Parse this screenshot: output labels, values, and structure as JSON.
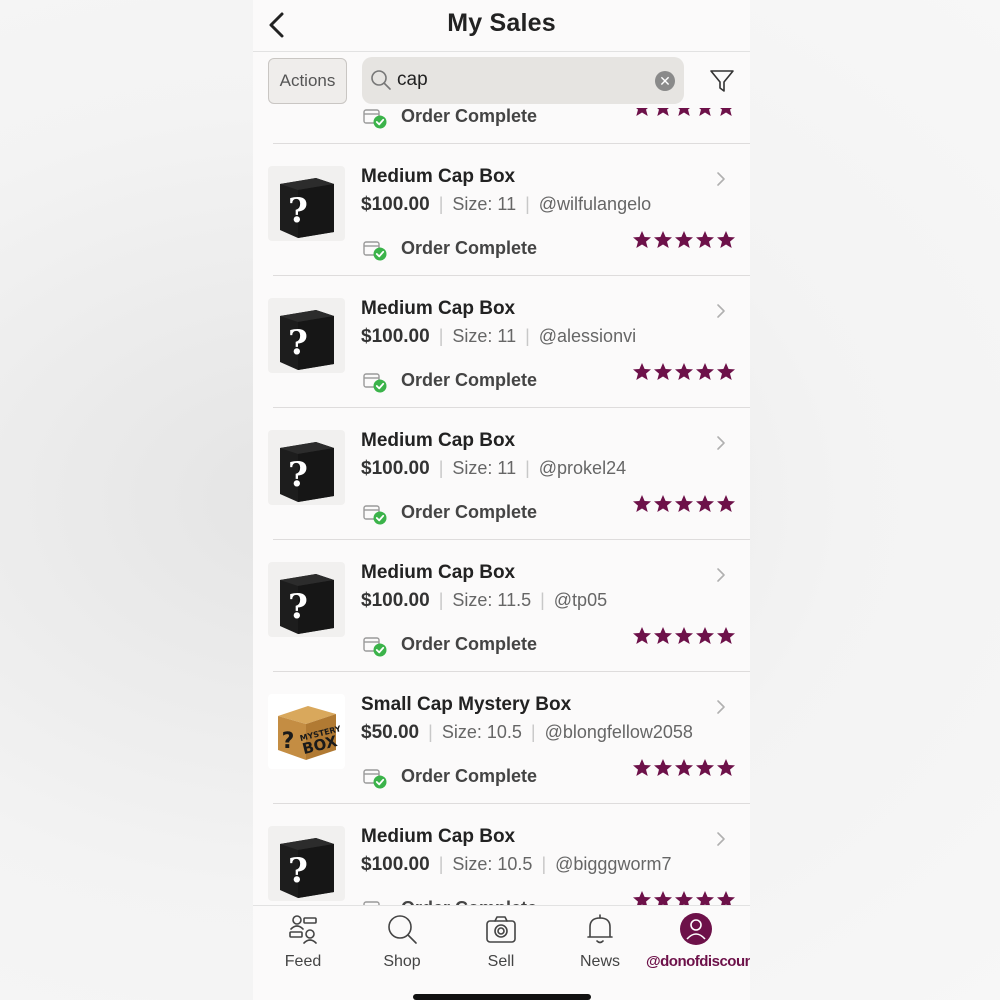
{
  "header": {
    "title": "My Sales"
  },
  "toolbar": {
    "actions_label": "Actions",
    "search_value": "cap"
  },
  "colors": {
    "accent": "#6d1149",
    "star": "#6d1149",
    "status_check": "#3bb34a"
  },
  "partial_top_row": {
    "status": "Order Complete",
    "rating": 5
  },
  "sales": [
    {
      "title": "Medium Cap Box",
      "price": "$100.00",
      "size": "Size: 11",
      "buyer": "@wilfulangelo",
      "status": "Order Complete",
      "rating": 5,
      "image": "black-mystery-box"
    },
    {
      "title": "Medium Cap Box",
      "price": "$100.00",
      "size": "Size: 11",
      "buyer": "@alessionvi",
      "status": "Order Complete",
      "rating": 5,
      "image": "black-mystery-box"
    },
    {
      "title": "Medium Cap Box",
      "price": "$100.00",
      "size": "Size: 11",
      "buyer": "@prokel24",
      "status": "Order Complete",
      "rating": 5,
      "image": "black-mystery-box"
    },
    {
      "title": "Medium Cap Box",
      "price": "$100.00",
      "size": "Size: 11.5",
      "buyer": "@tp05",
      "status": "Order Complete",
      "rating": 5,
      "image": "black-mystery-box"
    },
    {
      "title": "Small Cap Mystery Box",
      "price": "$50.00",
      "size": "Size: 10.5",
      "buyer": "@blongfellow2058",
      "status": "Order Complete",
      "rating": 5,
      "image": "cardboard-mystery-box",
      "image_text": [
        "MYSTERY",
        "BOX"
      ]
    },
    {
      "title": "Medium Cap Box",
      "price": "$100.00",
      "size": "Size: 10.5",
      "buyer": "@bigggworm7",
      "status": "Order Complete",
      "rating": 5,
      "image": "black-mystery-box"
    }
  ],
  "tabs": [
    {
      "label": "Feed",
      "icon": "feed-icon"
    },
    {
      "label": "Shop",
      "icon": "search-icon"
    },
    {
      "label": "Sell",
      "icon": "camera-icon"
    },
    {
      "label": "News",
      "icon": "bell-icon"
    },
    {
      "label": "@donofdiscounts",
      "icon": "profile-icon",
      "active": true
    }
  ]
}
